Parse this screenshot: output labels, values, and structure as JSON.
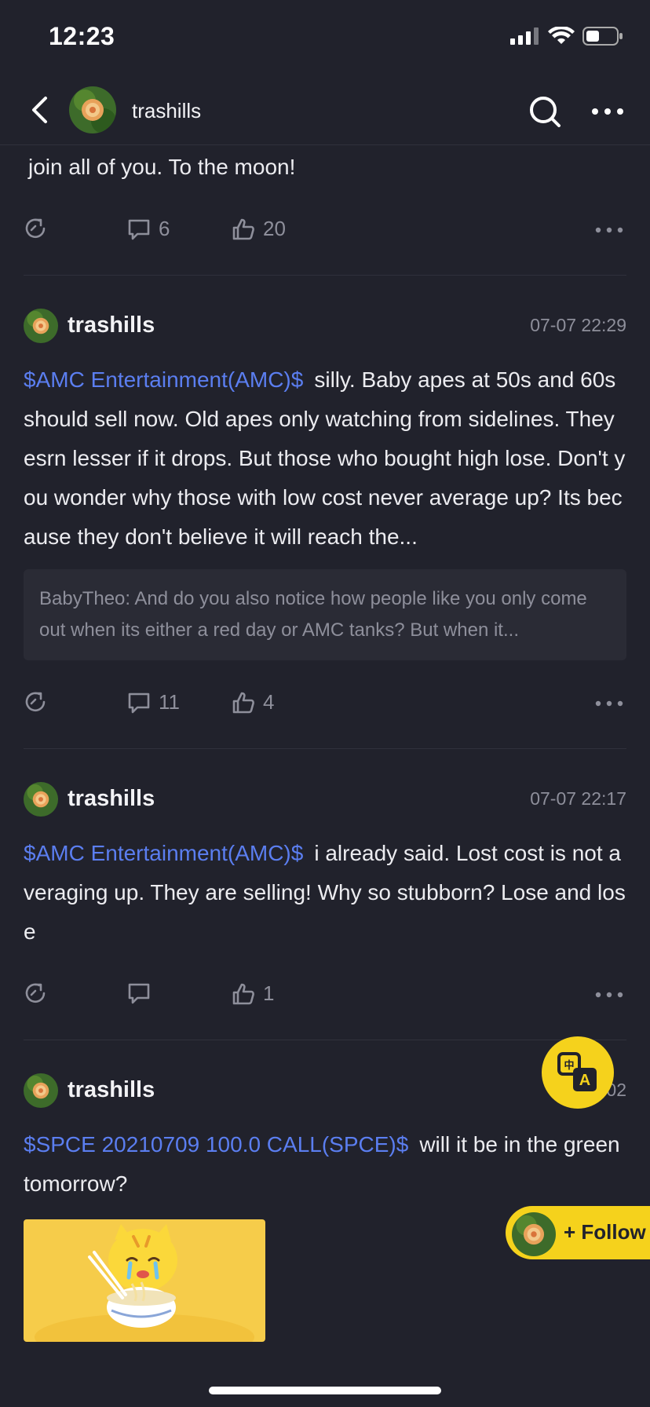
{
  "status": {
    "time": "12:23"
  },
  "nav": {
    "title": "trashills"
  },
  "colors": {
    "background": "#21222c",
    "accent": "#f5d21c",
    "ticker": "#5b7ef0",
    "muted": "#8e8f9b"
  },
  "posts": [
    {
      "text": "join all of you. To the moon!",
      "comments": "6",
      "likes": "20"
    },
    {
      "author": "trashills",
      "time": "07-07 22:29",
      "ticker": "$AMC Entertainment(AMC)$",
      "text": "silly. Baby apes at 50s and 60s should sell now. Old apes only watching from sidelines. They esrn lesser if it drops. But those who bought high lose. Don't you wonder why those with low cost never average up?  Its because they don't believe it will reach the...",
      "quote": "BabyTheo: And do you also notice how people like you only come out when its either a red day or AMC tanks? But when it...",
      "comments": "11",
      "likes": "4"
    },
    {
      "author": "trashills",
      "time": "07-07 22:17",
      "ticker": "$AMC Entertainment(AMC)$",
      "text": "i already said. Lost cost is not averaging up. They are selling! Why so stubborn? Lose and lose",
      "comments": "",
      "likes": "1"
    },
    {
      "author": "trashills",
      "time": "07-02",
      "ticker": "$SPCE 20210709 100.0 CALL(SPCE)$",
      "text": "will it be in the green tomorrow?"
    }
  ],
  "follow": {
    "label": "+ Follow"
  },
  "icons": [
    "back-icon",
    "search-icon",
    "more-icon",
    "share-icon",
    "comment-icon",
    "like-icon",
    "translate-icon"
  ]
}
